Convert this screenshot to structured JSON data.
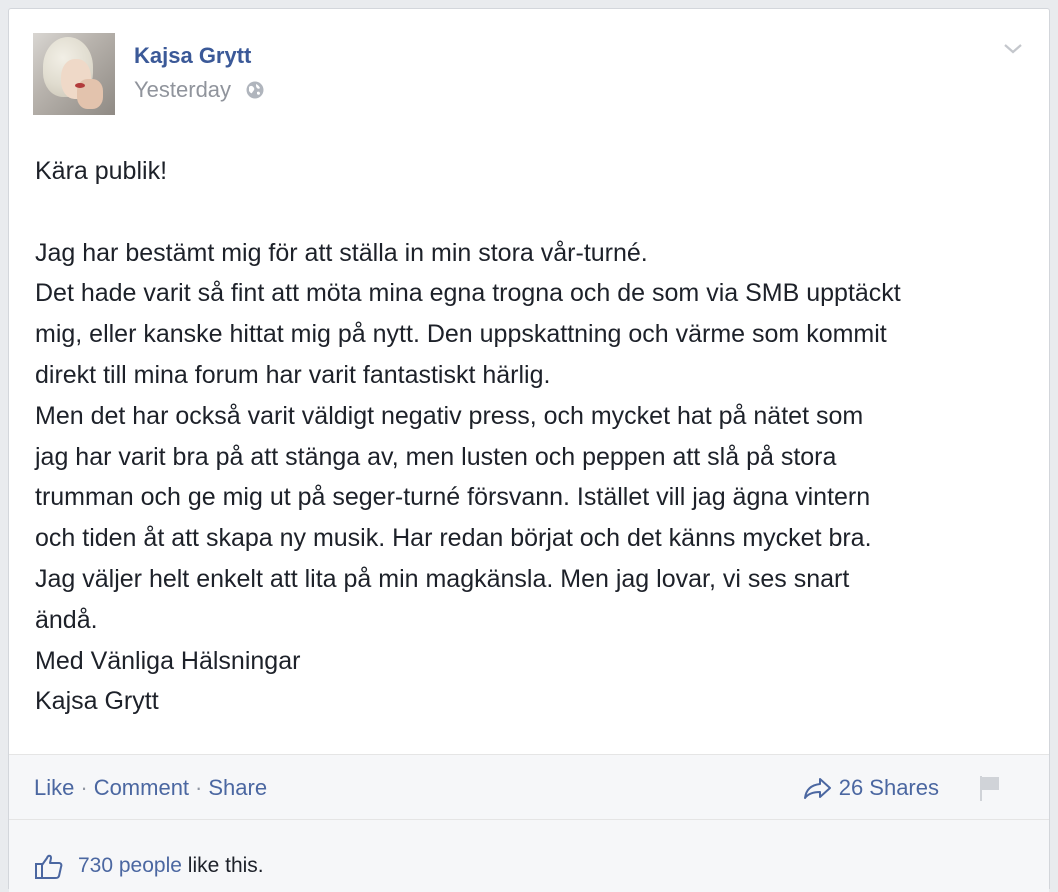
{
  "post": {
    "author": "Kajsa Grytt",
    "timestamp": "Yesterday",
    "privacy_icon": "globe-icon",
    "menu_icon": "chevron-down-icon"
  },
  "content": {
    "greeting": "Kära publik!",
    "lines": [
      "Jag har bestämt mig för att ställa in min stora vår-turné.",
      "Det hade varit så fint att möta mina egna trogna och de som via SMB upptäckt",
      "mig, eller kanske hittat mig på nytt. Den uppskattning och värme som kommit",
      "direkt till mina forum har varit fantastiskt härlig.",
      "Men det har också varit väldigt negativ press, och mycket hat på nätet som",
      "jag har varit bra på att stänga av, men lusten och peppen att slå på stora",
      "trumman och ge mig ut på seger-turné försvann. Istället vill jag ägna vintern",
      "och tiden åt att skapa ny musik. Har redan börjat och det känns mycket bra.",
      "Jag väljer helt enkelt att lita på min magkänsla. Men jag lovar, vi ses snart",
      "ändå.",
      "Med Vänliga Hälsningar",
      "Kajsa Grytt"
    ]
  },
  "actions": {
    "like": "Like",
    "comment": "Comment",
    "share": "Share",
    "separator": "·",
    "shares_count": "26 Shares"
  },
  "likes": {
    "people": "730 people",
    "suffix": " like this."
  },
  "colors": {
    "link": "#3b5998",
    "text": "#1d2129",
    "muted": "#90949c"
  }
}
